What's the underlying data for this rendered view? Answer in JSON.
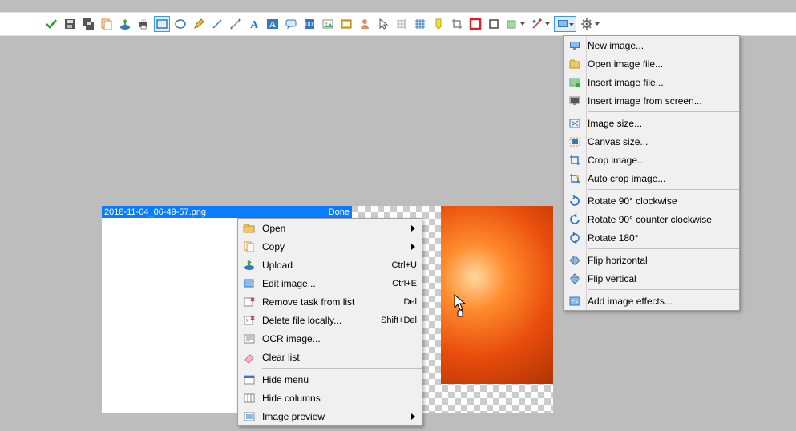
{
  "toolbar_icons": [
    "confirm",
    "save",
    "save-all",
    "copy",
    "upload",
    "print",
    "rect-region",
    "ellipse-region",
    "pencil",
    "line",
    "draw-line",
    "text",
    "text-fx",
    "chat",
    "sticky",
    "image",
    "slideshow",
    "user",
    "pointer",
    "grid",
    "grid2",
    "highlighter",
    "crop",
    "stop",
    "rect-outline",
    "fill",
    "tools",
    "monitor",
    "gear"
  ],
  "task": {
    "filename": "2018-11-04_06-49-57.png",
    "status": "Done"
  },
  "context_menu": [
    {
      "icon": "folder-open",
      "label": "Open",
      "shortcut": "",
      "arrow": true
    },
    {
      "icon": "copy",
      "label": "Copy",
      "shortcut": "",
      "arrow": true
    },
    {
      "icon": "upload",
      "label": "Upload",
      "shortcut": "Ctrl+U"
    },
    {
      "icon": "edit-image",
      "label": "Edit image...",
      "shortcut": "Ctrl+E"
    },
    {
      "icon": "remove-x",
      "label": "Remove task from list",
      "shortcut": "Del"
    },
    {
      "icon": "delete-x",
      "label": "Delete file locally...",
      "shortcut": "Shift+Del"
    },
    {
      "icon": "ocr",
      "label": "OCR image..."
    },
    {
      "icon": "eraser",
      "label": "Clear list"
    },
    {
      "sep": true
    },
    {
      "icon": "panel",
      "label": "Hide menu"
    },
    {
      "icon": "columns",
      "label": "Hide columns"
    },
    {
      "icon": "preview",
      "label": "Image preview",
      "arrow": true
    }
  ],
  "image_menu": {
    "groups": [
      [
        {
          "icon": "monitor-blue",
          "label": "New image..."
        },
        {
          "icon": "folder",
          "label": "Open image file..."
        },
        {
          "icon": "insert-image",
          "label": "Insert image file..."
        },
        {
          "icon": "screen-grab",
          "label": "Insert image from screen..."
        }
      ],
      [
        {
          "icon": "image-size",
          "label": "Image size..."
        },
        {
          "icon": "canvas-size",
          "label": "Canvas size..."
        },
        {
          "icon": "crop",
          "label": "Crop image..."
        },
        {
          "icon": "auto-crop",
          "label": "Auto crop image..."
        }
      ],
      [
        {
          "icon": "rotate-cw",
          "label": "Rotate 90° clockwise"
        },
        {
          "icon": "rotate-ccw",
          "label": "Rotate 90° counter clockwise"
        },
        {
          "icon": "rotate-180",
          "label": "Rotate 180°"
        }
      ],
      [
        {
          "icon": "flip-h",
          "label": "Flip horizontal"
        },
        {
          "icon": "flip-v",
          "label": "Flip vertical"
        }
      ],
      [
        {
          "icon": "effects",
          "label": "Add image effects..."
        }
      ]
    ]
  }
}
